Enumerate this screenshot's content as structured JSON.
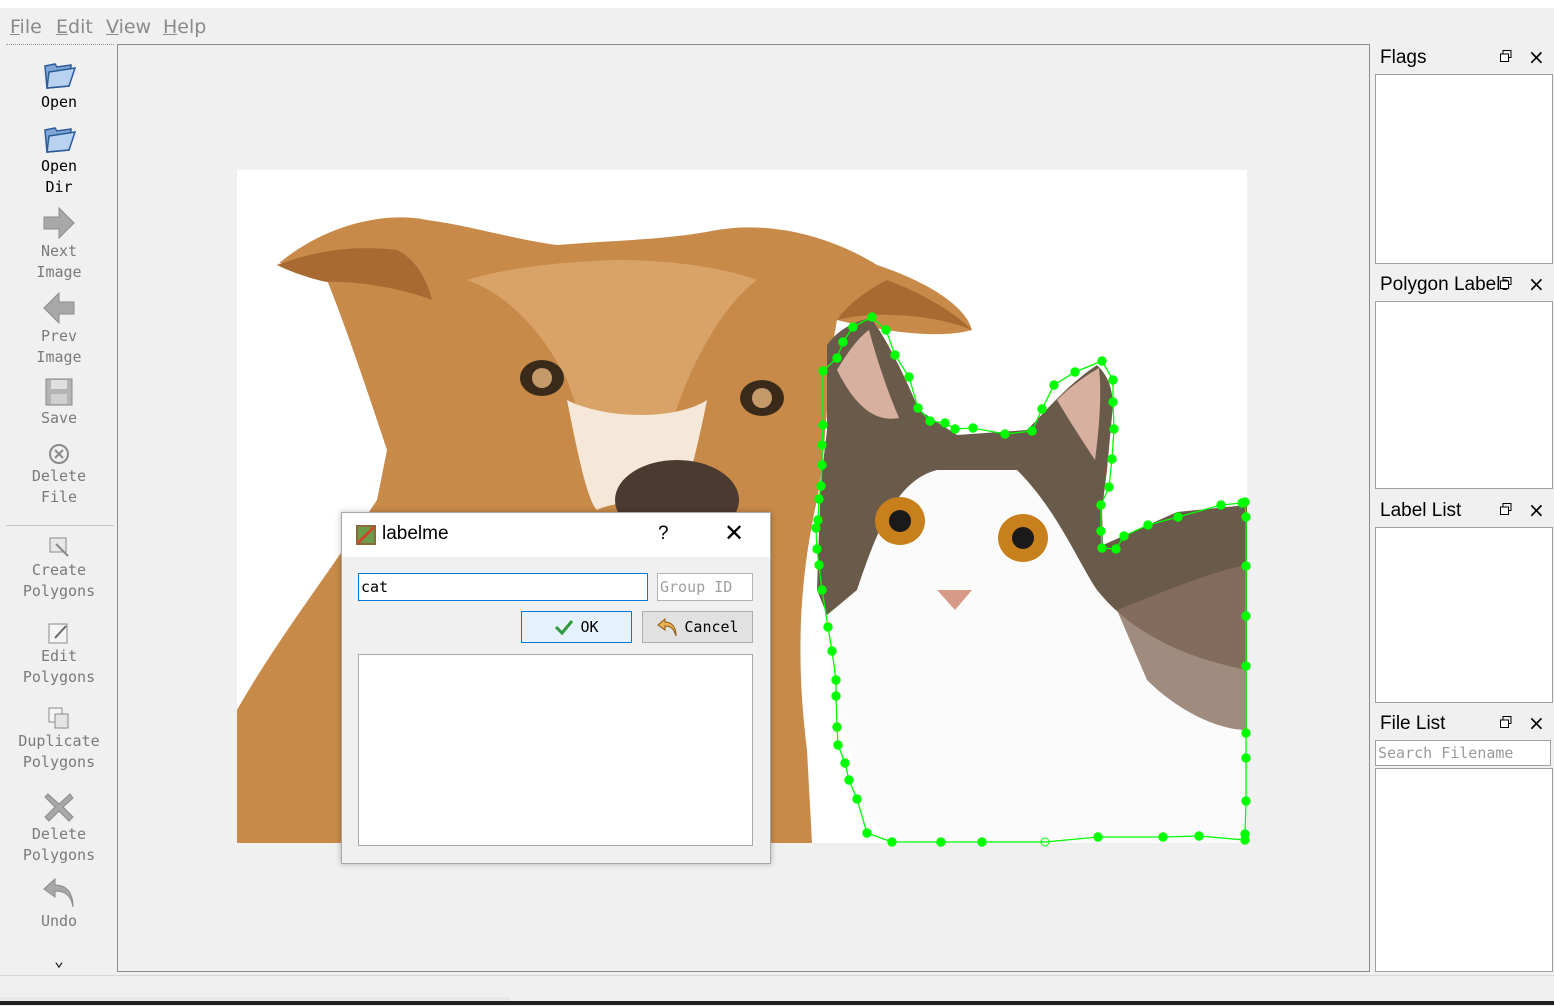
{
  "menu": [
    {
      "first": "F",
      "rest": "ile"
    },
    {
      "first": "E",
      "rest": "dit"
    },
    {
      "first": "V",
      "rest": "iew"
    },
    {
      "first": "H",
      "rest": "elp"
    }
  ],
  "toolbar": {
    "open": "Open",
    "open_dir": "Open\nDir",
    "next_image": "Next\nImage",
    "prev_image": "Prev\nImage",
    "save": "Save",
    "delete_file": "Delete\nFile",
    "create_polygons": "Create\nPolygons",
    "edit_polygons": "Edit\nPolygons",
    "duplicate_polygons": "Duplicate\nPolygons",
    "delete_polygons": "Delete\nPolygons",
    "undo": "Undo",
    "more": "⌄"
  },
  "docks": {
    "flags": "Flags",
    "polygon_labels": "Polygon Labels",
    "label_list": "Label List",
    "file_list": "File List",
    "search_placeholder": "Search Filename"
  },
  "dialog": {
    "title": "labelme",
    "help": "?",
    "label_value": "cat",
    "group_placeholder": "Group ID",
    "ok": "OK",
    "cancel": "Cancel"
  },
  "colors": {
    "polygon": "#00ff00",
    "accent": "#0078d7"
  },
  "icons": {
    "dialog_icon": "labelme-app-icon",
    "ok_icon": "checkmark-icon",
    "cancel_icon": "undo-arrow-icon",
    "dock_float": "float-window-icon",
    "dock_close": "close-icon"
  }
}
